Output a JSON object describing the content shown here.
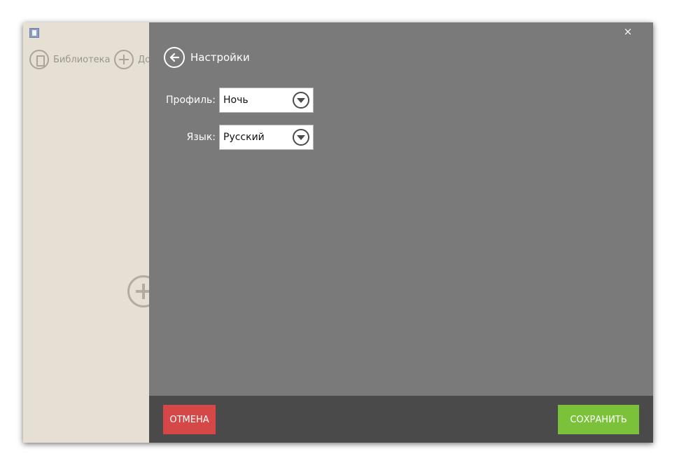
{
  "background_app": {
    "toolbar": {
      "library_label": "Библиотека",
      "add_label": "До"
    },
    "icons": {
      "app": "app-icon",
      "library": "book-icon",
      "add": "plus-circle-icon",
      "big_add": "plus-circle-icon"
    }
  },
  "settings": {
    "close_glyph": "×",
    "title": "Настройки",
    "fields": {
      "profile": {
        "label": "Профиль:",
        "value": "Ночь"
      },
      "language": {
        "label": "Язык:",
        "value": "Русский"
      }
    },
    "buttons": {
      "cancel": "ОТМЕНА",
      "save": "СОХРАНИТЬ"
    }
  },
  "colors": {
    "panel_bg": "#7a7a7a",
    "footer_bg": "#4a4a4a",
    "cancel": "#d64848",
    "save": "#7bc13a",
    "app_bg": "#e6dfd3"
  }
}
